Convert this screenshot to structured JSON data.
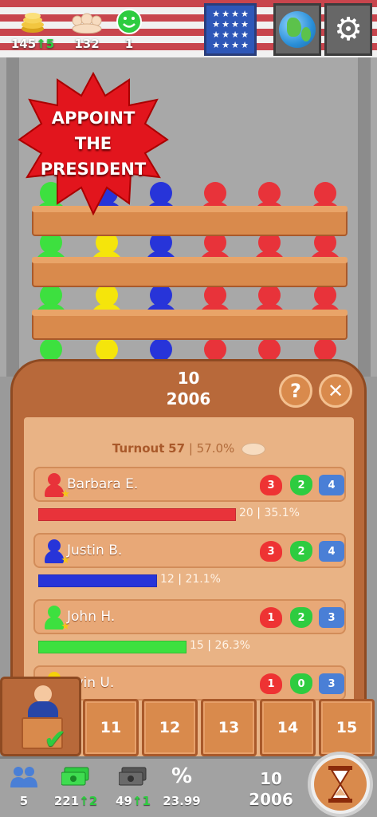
{
  "topbar": {
    "coins": {
      "icon": "coins-icon",
      "value": "145",
      "delta": "5"
    },
    "crowd": {
      "icon": "crowd-icon",
      "value": "132"
    },
    "happiness": {
      "icon": "smiley-icon",
      "value": "1"
    },
    "flag_button": "us-flag-icon",
    "world_button": "globe-icon",
    "settings_button": "gears-icon"
  },
  "banner": {
    "line1": "APPOINT",
    "line2": "THE",
    "line3": "PRESIDENT"
  },
  "panel": {
    "number": "10",
    "year": "2006",
    "help": "?",
    "close": "✕",
    "turnout_label": "Turnout",
    "turnout_value": "57",
    "turnout_pct": "57.0%"
  },
  "candidates": [
    {
      "name": "Barbara E.",
      "color": "#e8333a",
      "heart": "3",
      "shield": "2",
      "hands": "4",
      "votes": "20",
      "pct": "35.1%",
      "share": 0.351
    },
    {
      "name": "Justin B.",
      "color": "#2734d9",
      "heart": "3",
      "shield": "2",
      "hands": "4",
      "votes": "12",
      "pct": "21.1%",
      "share": 0.211
    },
    {
      "name": "John H.",
      "color": "#3de03f",
      "heart": "1",
      "shield": "2",
      "hands": "3",
      "votes": "15",
      "pct": "26.3%",
      "share": 0.263
    },
    {
      "name": "evin U.",
      "color": "#f5d20b",
      "heart": "1",
      "shield": "0",
      "hands": "3"
    }
  ],
  "tabs": [
    "11",
    "12",
    "13",
    "14",
    "15"
  ],
  "bottombar": {
    "population": {
      "icon": "people-icon",
      "value": "5"
    },
    "cash": {
      "icon": "banknote-icon",
      "value": "221",
      "delta": "2"
    },
    "debt": {
      "icon": "dark-banknote-icon",
      "value": "49",
      "delta": "1"
    },
    "rate": {
      "icon": "percent-icon",
      "symbol": "%",
      "value": "23.99"
    },
    "number": "10",
    "year": "2006",
    "hourglass": "hourglass-icon"
  }
}
